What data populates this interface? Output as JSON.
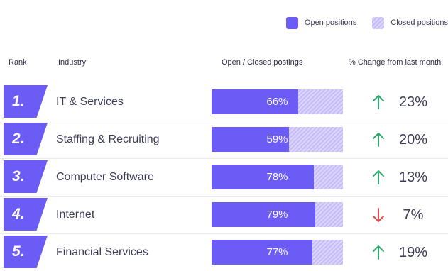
{
  "legend": {
    "open_label": "Open positions",
    "closed_label": "Closed positions",
    "open_color": "#6a5cf5",
    "closed_color": "#cfc6fa"
  },
  "headers": {
    "rank": "Rank",
    "industry": "Industry",
    "open_closed": "Open / Closed postings",
    "change": "% Change from last month"
  },
  "rows": [
    {
      "rank": "1.",
      "industry": "IT & Services",
      "open_pct": 66,
      "open_pct_label": "66%",
      "direction": "up",
      "change": "23%"
    },
    {
      "rank": "2.",
      "industry": "Staffing & Recruiting",
      "open_pct": 59,
      "open_pct_label": "59%",
      "direction": "up",
      "change": "20%"
    },
    {
      "rank": "3.",
      "industry": "Computer Software",
      "open_pct": 78,
      "open_pct_label": "78%",
      "direction": "up",
      "change": "13%"
    },
    {
      "rank": "4.",
      "industry": "Internet",
      "open_pct": 79,
      "open_pct_label": "79%",
      "direction": "down",
      "change": "7%"
    },
    {
      "rank": "5.",
      "industry": "Financial Services",
      "open_pct": 77,
      "open_pct_label": "77%",
      "direction": "up",
      "change": "19%"
    }
  ],
  "colors": {
    "up": "#2fa86d",
    "down": "#e5484d"
  },
  "chart_data": {
    "type": "bar",
    "categories": [
      "IT & Services",
      "Staffing & Recruiting",
      "Computer Software",
      "Internet",
      "Financial Services"
    ],
    "series": [
      {
        "name": "Open positions",
        "values": [
          66,
          59,
          78,
          79,
          77
        ]
      },
      {
        "name": "Closed positions",
        "values": [
          34,
          41,
          22,
          21,
          23
        ]
      }
    ],
    "change_from_last_month": [
      23,
      20,
      13,
      -7,
      19
    ],
    "ylim": [
      0,
      100
    ],
    "legend": "top-right",
    "grid": false
  }
}
